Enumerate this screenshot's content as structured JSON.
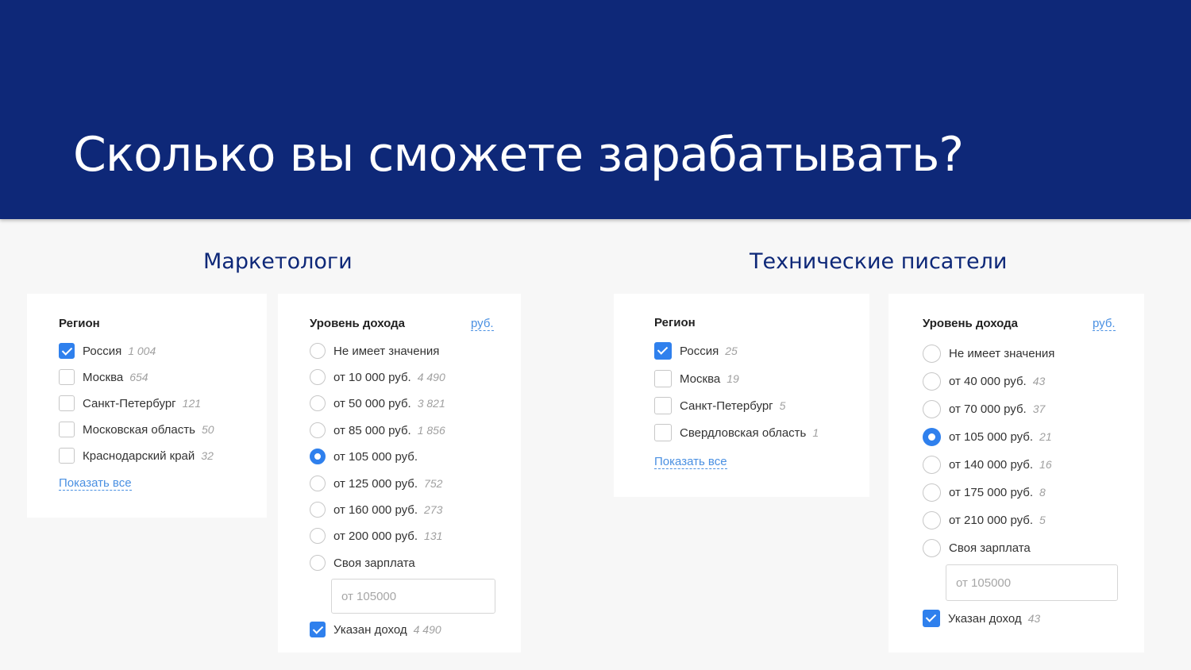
{
  "slide": {
    "title": "Сколько вы сможете зарабатывать?"
  },
  "left": {
    "title": "Маркетологи",
    "region": {
      "heading": "Регион",
      "items": [
        {
          "label": "Россия",
          "count": "1 004",
          "checked": true
        },
        {
          "label": "Москва",
          "count": "654",
          "checked": false
        },
        {
          "label": "Санкт-Петербург",
          "count": "121",
          "checked": false
        },
        {
          "label": "Московская область",
          "count": "50",
          "checked": false
        },
        {
          "label": "Краснодарский край",
          "count": "32",
          "checked": false
        }
      ],
      "show_all": "Показать все"
    },
    "income": {
      "heading": "Уровень дохода",
      "currency": "руб.",
      "options": [
        {
          "label": "Не имеет значения",
          "count": ""
        },
        {
          "label": "от 10 000 руб.",
          "count": "4 490"
        },
        {
          "label": "от 50 000 руб.",
          "count": "3 821"
        },
        {
          "label": "от 85 000 руб.",
          "count": "1 856"
        },
        {
          "label": "от 105 000 руб.",
          "count": "",
          "selected": true
        },
        {
          "label": "от 125 000 руб.",
          "count": "752"
        },
        {
          "label": "от 160 000 руб.",
          "count": "273"
        },
        {
          "label": "от 200 000 руб.",
          "count": "131"
        },
        {
          "label": "Своя зарплата",
          "count": ""
        }
      ],
      "salary_placeholder": "от 105000",
      "indicated": {
        "label": "Указан доход",
        "count": "4 490",
        "checked": true
      }
    }
  },
  "right": {
    "title": "Технические писатели",
    "region": {
      "heading": "Регион",
      "items": [
        {
          "label": "Россия",
          "count": "25",
          "checked": true
        },
        {
          "label": "Москва",
          "count": "19",
          "checked": false
        },
        {
          "label": "Санкт-Петербург",
          "count": "5",
          "checked": false
        },
        {
          "label": "Свердловская область",
          "count": "1",
          "checked": false
        }
      ],
      "show_all": "Показать все"
    },
    "income": {
      "heading": "Уровень дохода",
      "currency": "руб.",
      "options": [
        {
          "label": "Не имеет значения",
          "count": ""
        },
        {
          "label": "от 40 000 руб.",
          "count": "43"
        },
        {
          "label": "от 70 000 руб.",
          "count": "37"
        },
        {
          "label": "от 105 000 руб.",
          "count": "21",
          "selected": true
        },
        {
          "label": "от 140 000 руб.",
          "count": "16"
        },
        {
          "label": "от 175 000 руб.",
          "count": "8"
        },
        {
          "label": "от 210 000 руб.",
          "count": "5"
        },
        {
          "label": "Своя зарплата",
          "count": ""
        }
      ],
      "salary_placeholder": "от 105000",
      "indicated": {
        "label": "Указан доход",
        "count": "43",
        "checked": true
      }
    }
  },
  "colors": {
    "header_bg": "#0e2878",
    "accent": "#2f80ed",
    "link": "#4a90e2"
  }
}
